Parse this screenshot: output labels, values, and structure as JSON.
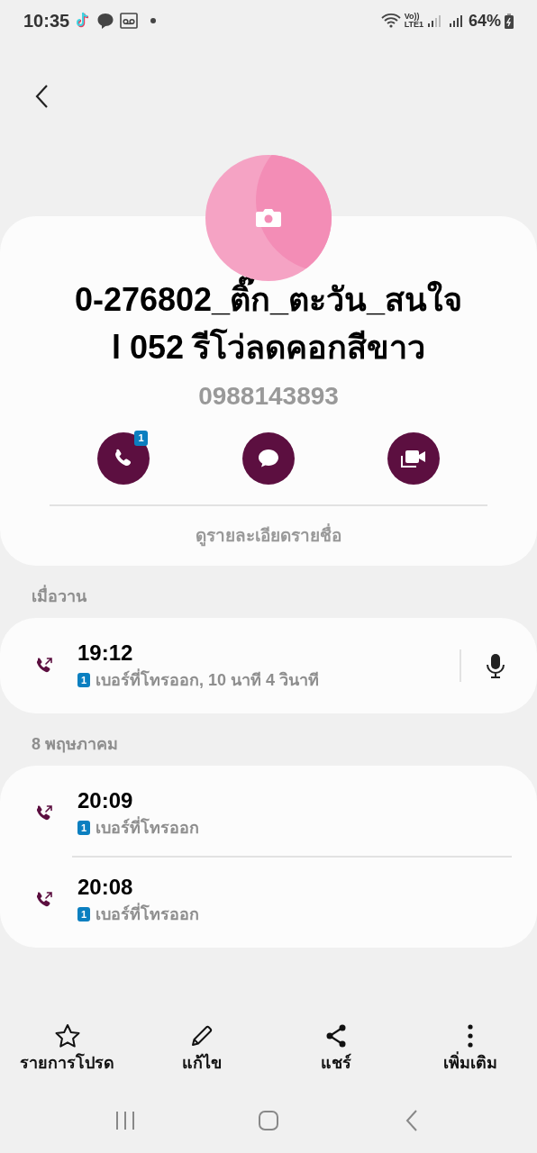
{
  "status_bar": {
    "time": "10:35",
    "network_top": "Vo))",
    "network_bottom": "LTE1",
    "battery": "64%"
  },
  "contact": {
    "name_lines": [
      "0-276802_ติ๊ก_ตะวัน_สนใจ",
      "l 052 รีโว่ลดคอกสีขาว"
    ],
    "number": "0988143893",
    "call_badge": "1",
    "details_link": "ดูรายละเอียดรายชื่อ"
  },
  "call_groups": [
    {
      "date": "เมื่อวาน",
      "calls": [
        {
          "kind": "outgoing",
          "time": "19:12",
          "sim": "1",
          "detail": "เบอร์ที่โทรออก, 10 นาที 4 วินาที",
          "recording": true
        }
      ]
    },
    {
      "date": "8 พฤษภาคม",
      "calls": [
        {
          "kind": "outgoing",
          "time": "20:09",
          "sim": "1",
          "detail": "เบอร์ที่โทรออก",
          "recording": false
        },
        {
          "kind": "outgoing",
          "time": "20:08",
          "sim": "1",
          "detail": "เบอร์ที่โทรออก",
          "recording": false
        }
      ]
    }
  ],
  "bottom_actions": [
    {
      "kind": "favorite",
      "label": "รายการโปรด"
    },
    {
      "kind": "edit",
      "label": "แก้ไข"
    },
    {
      "kind": "share",
      "label": "แชร์"
    },
    {
      "kind": "more",
      "label": "เพิ่มเติม"
    }
  ]
}
